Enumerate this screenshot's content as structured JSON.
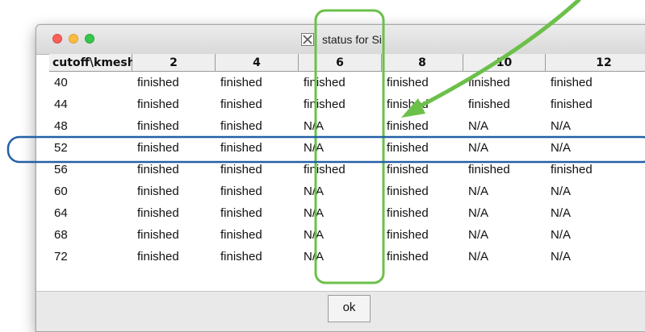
{
  "window": {
    "title": "status for Si",
    "title_icon": "x11-icon",
    "traffic_lights": [
      "close",
      "minimize",
      "zoom"
    ]
  },
  "table": {
    "columns": [
      "cutoff\\kmesh",
      "2",
      "4",
      "6",
      "8",
      "10",
      "12"
    ],
    "rows": [
      [
        "40",
        "finished",
        "finished",
        "finished",
        "finished",
        "finished",
        "finished"
      ],
      [
        "44",
        "finished",
        "finished",
        "finished",
        "finished",
        "finished",
        "finished"
      ],
      [
        "48",
        "finished",
        "finished",
        "N/A",
        "finished",
        "N/A",
        "N/A"
      ],
      [
        "52",
        "finished",
        "finished",
        "N/A",
        "finished",
        "N/A",
        "N/A"
      ],
      [
        "56",
        "finished",
        "finished",
        "finished",
        "finished",
        "finished",
        "finished"
      ],
      [
        "60",
        "finished",
        "finished",
        "N/A",
        "finished",
        "N/A",
        "N/A"
      ],
      [
        "64",
        "finished",
        "finished",
        "N/A",
        "finished",
        "N/A",
        "N/A"
      ],
      [
        "68",
        "finished",
        "finished",
        "N/A",
        "finished",
        "N/A",
        "N/A"
      ],
      [
        "72",
        "finished",
        "finished",
        "N/A",
        "finished",
        "N/A",
        "N/A"
      ]
    ]
  },
  "footer": {
    "ok_label": "ok"
  },
  "annotations": {
    "green": "#6cc04a",
    "blue": "#2360a5",
    "highlighted_column": "6",
    "highlighted_row": "52"
  }
}
